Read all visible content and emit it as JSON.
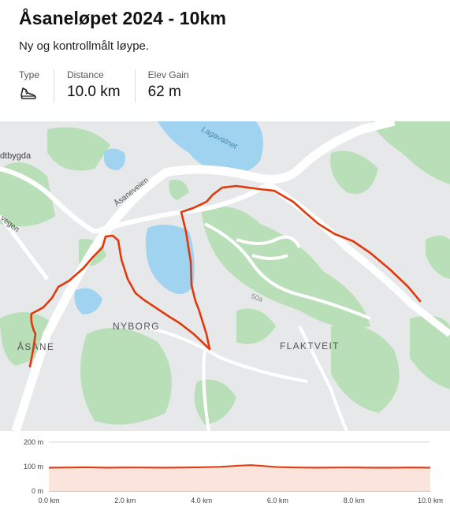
{
  "activity": {
    "title": "Åsaneløpet 2024 - 10km",
    "description": "Ny og kontrollmålt løype."
  },
  "stats": {
    "type_label": "Type",
    "type_icon": "running-shoe-icon",
    "distance_label": "Distance",
    "distance_value": "10.0 km",
    "elev_label": "Elev Gain",
    "elev_value": "62 m"
  },
  "map": {
    "route_color": "#e0390c",
    "labels": {
      "lake": "Lagavatnet",
      "road_aasaneveien": "Åsaneveien",
      "place_left_top": "dtbygda",
      "road_left": "vegen",
      "place_aasane": "ÅSANE",
      "place_nyborg": "NYBORG",
      "place_flaktveit": "FLAKTVEIT",
      "road_small": "50a"
    }
  },
  "chart_data": {
    "type": "area",
    "title": "",
    "xlabel": "",
    "ylabel": "",
    "x_ticks": [
      "0.0 km",
      "2.0 km",
      "4.0 km",
      "6.0 km",
      "8.0 km",
      "10.0 km"
    ],
    "y_ticks": [
      "0 m",
      "100 m",
      "200 m"
    ],
    "xlim": [
      0,
      10
    ],
    "ylim": [
      0,
      200
    ],
    "grid": true,
    "series": [
      {
        "x": [
          0,
          0.5,
          1,
          1.5,
          2,
          2.5,
          3,
          3.5,
          4,
          4.5,
          5,
          5.3,
          5.6,
          6,
          6.5,
          7,
          7.5,
          8,
          8.5,
          9,
          9.5,
          10
        ],
        "values": [
          95,
          96,
          97,
          95,
          96,
          96,
          95,
          96,
          97,
          99,
          104,
          106,
          103,
          98,
          96,
          95,
          96,
          96,
          95,
          95,
          96,
          95
        ]
      }
    ],
    "color": "#e0390c"
  }
}
